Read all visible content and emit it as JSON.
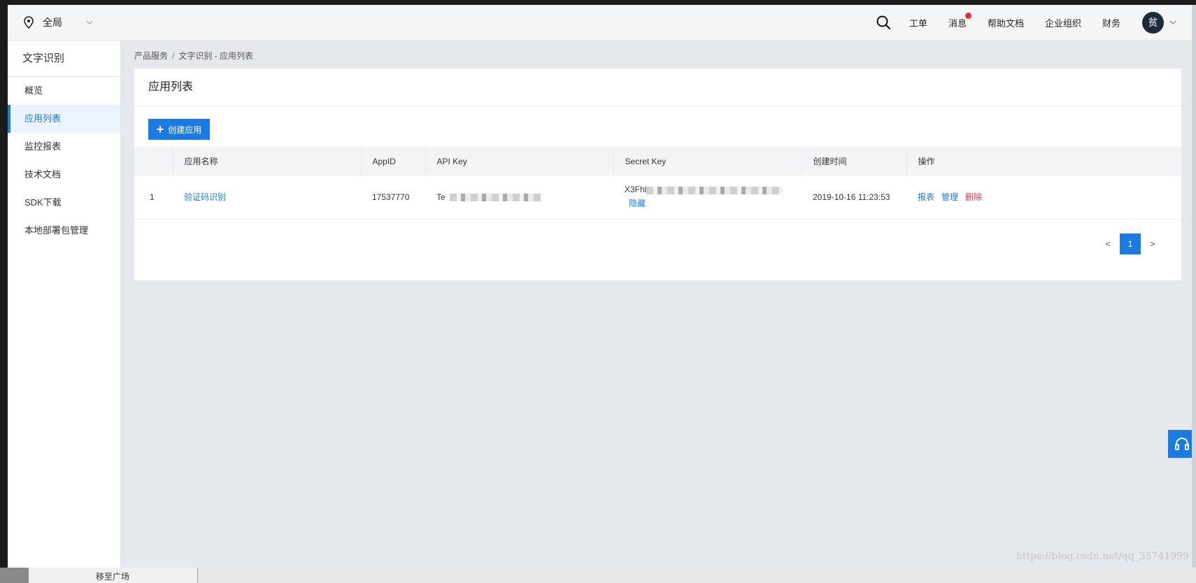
{
  "topbar": {
    "region": "全局",
    "links": {
      "ticket": "工单",
      "messages": "消息",
      "help": "帮助文档",
      "org": "企业组织",
      "finance": "财务"
    },
    "avatar": "贫"
  },
  "sidebar": {
    "title": "文字识别",
    "items": [
      {
        "label": "概览"
      },
      {
        "label": "应用列表"
      },
      {
        "label": "监控报表"
      },
      {
        "label": "技术文档"
      },
      {
        "label": "SDK下载"
      },
      {
        "label": "本地部署包管理"
      }
    ]
  },
  "breadcrumb": {
    "root": "产品服务",
    "sep": "/",
    "current": "文字识别 - 应用列表"
  },
  "card": {
    "title": "应用列表",
    "create_button": "创建应用"
  },
  "table": {
    "headers": [
      "应用名称",
      "AppID",
      "API Key",
      "Secret Key",
      "创建时间",
      "操作"
    ],
    "rows": [
      {
        "index": "1",
        "name": "验证码识别",
        "appid": "17537770",
        "api_key_prefix": "Te",
        "secret_key_prefix": "X3Fhl",
        "hide_label": "隐藏",
        "created": "2019-10-16 11:23:53",
        "ops": {
          "report": "报表",
          "manage": "管理",
          "delete": "删除"
        }
      }
    ]
  },
  "pagination": {
    "prev": "<",
    "current": "1",
    "next": ">"
  },
  "watermark": "https://blog.csdn.net/qq_35741999",
  "taskbar": {
    "tab_label": "移至广场"
  },
  "colors": {
    "accent": "#1b7be0",
    "danger": "#e5323e"
  }
}
